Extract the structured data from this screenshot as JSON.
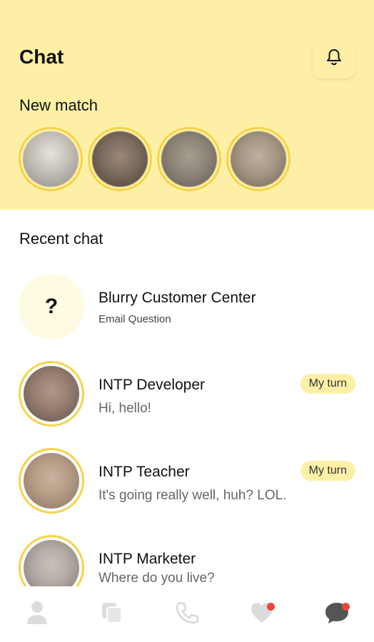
{
  "header": {
    "title": "Chat",
    "bell_icon": "bell-icon"
  },
  "new_match": {
    "label": "New match",
    "avatars": [
      {
        "colors": [
          "#c7c1ba",
          "#8e8a86"
        ]
      },
      {
        "colors": [
          "#7b6a5d",
          "#4a4039"
        ]
      },
      {
        "colors": [
          "#8d8478",
          "#5f5a52"
        ]
      },
      {
        "colors": [
          "#a69584",
          "#6f6457"
        ]
      }
    ]
  },
  "recent_chat": {
    "label": "Recent chat",
    "items": [
      {
        "name": "Blurry Customer Center",
        "subtitle": "Email Question",
        "avatar": "question-mark",
        "avatar_text": "?"
      },
      {
        "name": "INTP Developer",
        "message": "Hi, hello!",
        "badge": "My turn",
        "colors": [
          "#9a7f72",
          "#5e564b"
        ]
      },
      {
        "name": "INTP Teacher",
        "message": "It's going really well, huh? LOL.",
        "badge": "My turn",
        "colors": [
          "#b89e87",
          "#8a7463"
        ]
      },
      {
        "name": "INTP Marketer",
        "message": "Where do you live?",
        "colors": [
          "#b6aca8",
          "#7e7470"
        ]
      }
    ]
  },
  "nav": {
    "items": [
      "profile-icon",
      "cards-icon",
      "phone-icon",
      "heart-icon",
      "chat-icon"
    ],
    "notification_color": "#f04438"
  },
  "colors": {
    "accent": "#fdf0a6",
    "ring": "#f7d34a"
  }
}
